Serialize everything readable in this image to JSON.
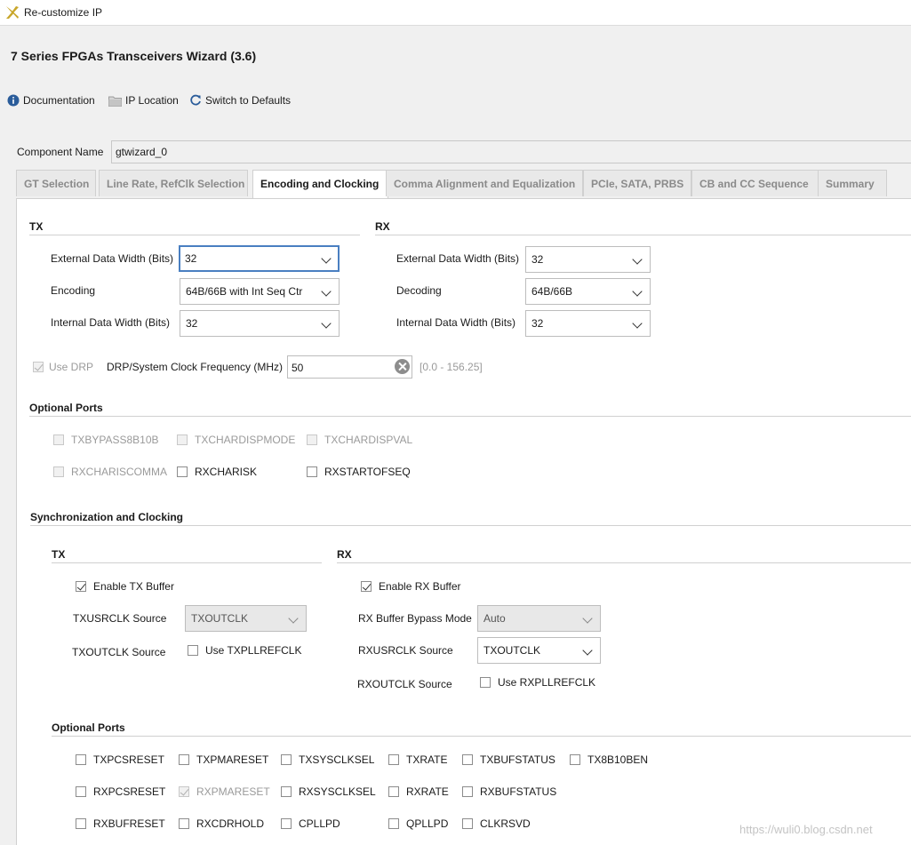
{
  "window": {
    "title": "Re-customize IP"
  },
  "wizard": {
    "title": "7 Series FPGAs Transceivers Wizard (3.6)"
  },
  "toolbar": {
    "documentation": "Documentation",
    "ip_location": "IP Location",
    "switch_defaults": "Switch to Defaults"
  },
  "component": {
    "label": "Component Name",
    "value": "gtwizard_0"
  },
  "tabs": [
    {
      "label": "GT Selection"
    },
    {
      "label": "Line Rate, RefClk Selection"
    },
    {
      "label": "Encoding and Clocking"
    },
    {
      "label": "Comma Alignment and Equalization"
    },
    {
      "label": "PCIe, SATA, PRBS"
    },
    {
      "label": "CB and CC Sequence"
    },
    {
      "label": "Summary"
    }
  ],
  "tx": {
    "title": "TX",
    "ext_width": {
      "label": "External Data Width (Bits)",
      "value": "32"
    },
    "encoding": {
      "label": "Encoding",
      "value": "64B/66B with Int Seq Ctr"
    },
    "int_width": {
      "label": "Internal Data Width (Bits)",
      "value": "32"
    }
  },
  "rx": {
    "title": "RX",
    "ext_width": {
      "label": "External Data Width (Bits)",
      "value": "32"
    },
    "decoding": {
      "label": "Decoding",
      "value": "64B/66B"
    },
    "int_width": {
      "label": "Internal Data Width (Bits)",
      "value": "32"
    }
  },
  "drp": {
    "use_drp": "Use DRP",
    "freq_label": "DRP/System Clock Frequency (MHz)",
    "freq_value": "50",
    "range": "[0.0 - 156.25]"
  },
  "optional_ports": {
    "title": "Optional Ports",
    "items": [
      "TXBYPASS8B10B",
      "TXCHARDISPMODE",
      "TXCHARDISPVAL",
      "RXCHARISCOMMA",
      "RXCHARISK",
      "RXSTARTOFSEQ"
    ]
  },
  "sync": {
    "title": "Synchronization and Clocking",
    "tx": {
      "title": "TX",
      "enable_buffer": "Enable TX Buffer",
      "usrclk_label": "TXUSRCLK Source",
      "usrclk_value": "TXOUTCLK",
      "outclk_label": "TXOUTCLK Source",
      "use_pllrefclk": "Use TXPLLREFCLK"
    },
    "rx": {
      "title": "RX",
      "enable_buffer": "Enable RX Buffer",
      "bypass_label": "RX Buffer Bypass Mode",
      "bypass_value": "Auto",
      "usrclk_label": "RXUSRCLK Source",
      "usrclk_value": "TXOUTCLK",
      "outclk_label": "RXOUTCLK Source",
      "use_pllrefclk": "Use RXPLLREFCLK"
    },
    "optional_ports": {
      "title": "Optional Ports",
      "row1": [
        "TXPCSRESET",
        "TXPMARESET",
        "TXSYSCLKSEL",
        "TXRATE",
        "TXBUFSTATUS",
        "TX8B10BEN"
      ],
      "row2": [
        "RXPCSRESET",
        "RXPMARESET",
        "RXSYSCLKSEL",
        "RXRATE",
        "RXBUFSTATUS"
      ],
      "row3": [
        "RXBUFRESET",
        "RXCDRHOLD",
        "CPLLPD",
        "QPLLPD",
        "CLKRSVD"
      ]
    }
  },
  "watermark": "https://wuli0.blog.csdn.net",
  "colors": {
    "accent": "#4a7fc1",
    "logo": "#c8a62a",
    "info": "#2a5c9a"
  }
}
